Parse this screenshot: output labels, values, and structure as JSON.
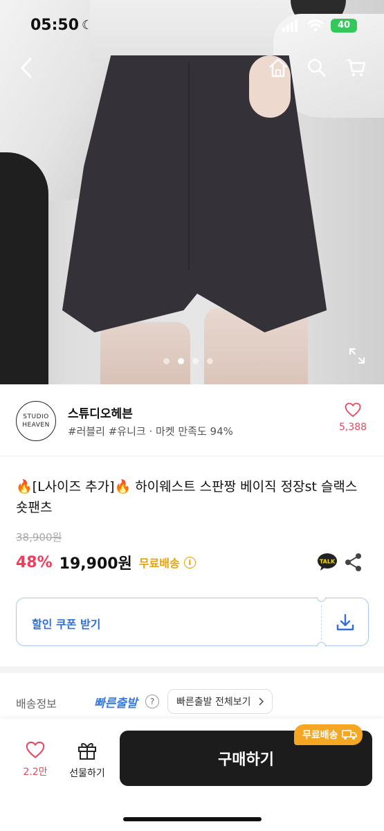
{
  "status_bar": {
    "time": "05:50",
    "battery": "40"
  },
  "carousel": {
    "count": 4,
    "active_index": 1
  },
  "shop": {
    "logo_line1": "STUDIO",
    "logo_line2": "HEAVEN",
    "name": "스튜디오헤븐",
    "tags": "#러블리 #유니크 · 마켓 만족도 94%",
    "like_count": "5,388"
  },
  "product": {
    "title": "🔥[L사이즈 추가]🔥 하이웨스트 스판짱 베이직 정장st 슬랙스 숏팬츠",
    "original_price": "38,900원",
    "discount": "48%",
    "price": "19,900원",
    "free_shipping": "무료배송"
  },
  "coupon": {
    "label": "할인 쿠폰 받기"
  },
  "shipping": {
    "label": "배송정보",
    "fast_label": "빠른출발",
    "view_all": "빠른출발 전체보기"
  },
  "bottom_bar": {
    "like_count": "2.2만",
    "gift_label": "선물하기",
    "buy_label": "구매하기",
    "ship_badge": "무료배송"
  },
  "colors": {
    "accent_pink": "#f03e5c",
    "free_ship_orange": "#e8a100",
    "coupon_blue": "#2f6fd8",
    "buy_button": "#1c1c1c"
  },
  "icons": [
    "back-icon",
    "home-icon",
    "search-icon",
    "cart-icon",
    "expand-icon",
    "heart-icon",
    "kakao-talk-icon",
    "share-icon",
    "download-icon",
    "question-icon",
    "chevron-right-icon",
    "gift-icon",
    "truck-icon"
  ]
}
